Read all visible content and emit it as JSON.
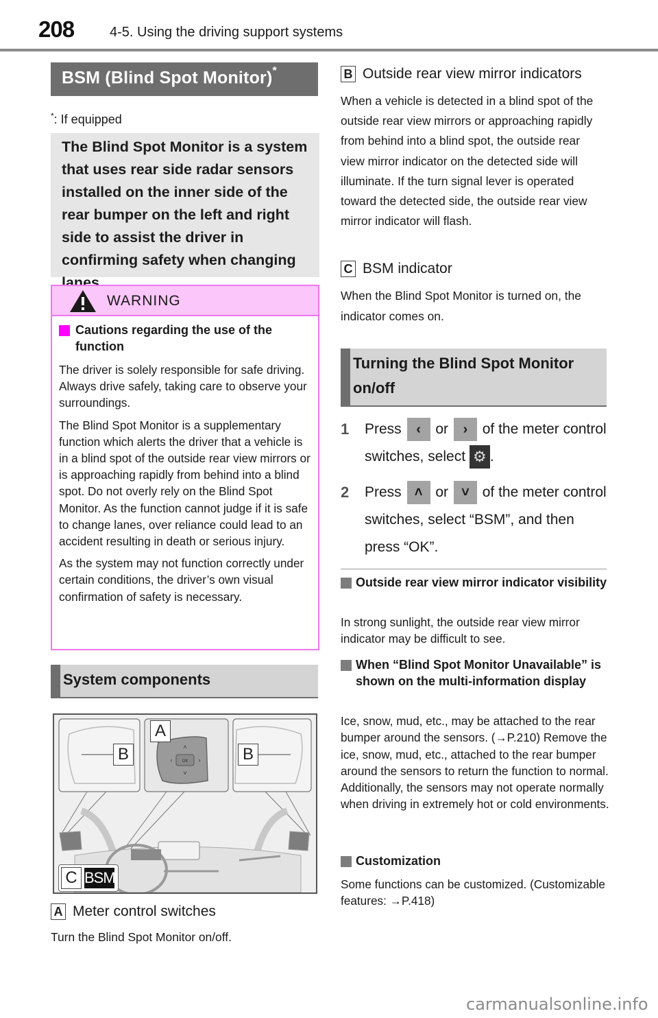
{
  "header": {
    "page_number": "208",
    "chapter": "4-5. Using the driving support systems"
  },
  "title": {
    "text": "BSM (Blind Spot Monitor)",
    "marker": "*"
  },
  "footnote": {
    "marker": "*",
    "text": ":  If equipped"
  },
  "intro": "The Blind Spot Monitor is a system that uses rear side radar sensors installed on the inner side of the rear bumper on the left and right side to assist the driver in confirming safety when changing lanes.",
  "warning": {
    "title": "WARNING",
    "subheading": "Cautions regarding the use of the function",
    "paragraphs": [
      "The driver is solely responsible for safe driving. Always drive safely, taking care to observe your surroundings.",
      "The Blind Spot Monitor is a supplementary function which alerts the driver that a vehicle is in a blind spot of the outside rear view mirrors or is approaching rapidly from behind into a blind spot. Do not overly rely on the Blind Spot Monitor. As the function cannot judge if it is safe to change lanes, over reliance could lead to an accident resulting in death or serious injury.",
      "As the system may not function correctly under certain conditions, the driver’s own visual confirmation of safety is necessary."
    ]
  },
  "system_components": {
    "heading": "System components",
    "illustration": {
      "labels": [
        "A",
        "B",
        "B",
        "C"
      ],
      "bsm_badge": "BSM",
      "switch_center": "OK"
    },
    "items": [
      {
        "label": "A",
        "title": "Meter control switches",
        "desc": "Turn the Blind Spot Monitor on/off."
      },
      {
        "label": "B",
        "title": "Outside rear view mirror indicators",
        "desc": "When a vehicle is detected in a blind spot of the outside rear view mirrors or approaching rapidly from behind into a blind spot, the outside rear view mirror indicator on the detected side will illuminate. If the turn signal lever is operated toward the detected side, the outside rear view mirror indicator will flash."
      },
      {
        "label": "C",
        "title": "BSM indicator",
        "desc": "When the Blind Spot Monitor is turned on, the indicator comes on."
      }
    ]
  },
  "turning": {
    "heading": "Turning the Blind Spot Monitor on/off",
    "steps": [
      {
        "num": "1",
        "pre": "Press",
        "or": "or",
        "mid": "of the meter control switches, select",
        "post": ".",
        "icons": [
          "chevron-left",
          "chevron-right",
          "gear"
        ]
      },
      {
        "num": "2",
        "pre": "Press",
        "or": "or",
        "mid": "of the meter control switches, select “BSM”, and then press “OK”.",
        "icons": [
          "chevron-up",
          "chevron-down"
        ]
      }
    ]
  },
  "notes": [
    {
      "heading": "Outside rear view mirror indicator visibility",
      "text": "In strong sunlight, the outside rear view mirror indicator may be difficult to see."
    },
    {
      "heading": "When “Blind Spot Monitor Unavailable” is shown on the multi-information display",
      "text": "Ice, snow, mud, etc., may be attached to the rear bumper around the sensors. (→P.210) Remove the ice, snow, mud, etc., attached to the rear bumper around the sensors to return the function to normal. Additionally, the sensors may not operate normally when driving in extremely hot or cold environments."
    },
    {
      "heading": "Customization",
      "text": "Some functions can be customized. (Customizable features: →P.418)"
    }
  ],
  "icons": {
    "chevron-left": "‹",
    "chevron-right": "›",
    "chevron-up": "˄",
    "chevron-down": "˅",
    "gear": "⚙",
    "warning": "warning-triangle"
  },
  "colors": {
    "warning_border": "#f076ef",
    "warning_header_bg": "#fbc6f9",
    "warning_square": "#ff00ff",
    "title_bar_bg": "#6e6e6e",
    "section_bg": "#d4d4d4",
    "intro_bg": "#e6e6e6"
  },
  "watermark": "carmanualsonline.info"
}
